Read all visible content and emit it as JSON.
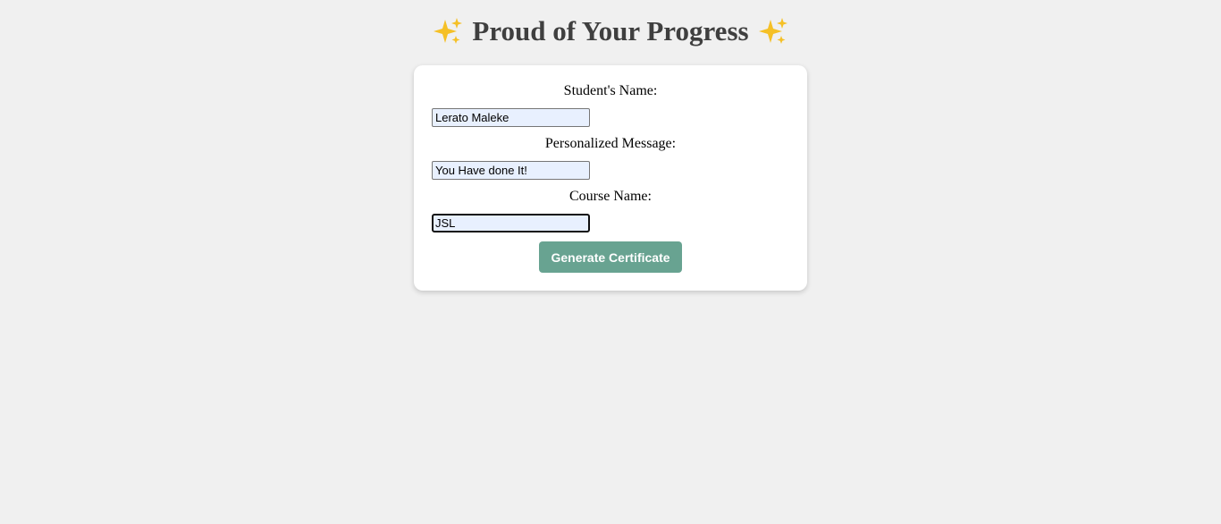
{
  "page": {
    "title": "Proud of Your Progress",
    "title_icon": "sparkles-icon",
    "title_icon_color": "#f5c026"
  },
  "form": {
    "student_name": {
      "label": "Student's Name:",
      "value": "Lerato Maleke"
    },
    "message": {
      "label": "Personalized Message:",
      "value": "You Have done It!"
    },
    "course": {
      "label": "Course Name:",
      "value": "JSL"
    },
    "submit_label": "Generate Certificate"
  },
  "colors": {
    "background": "#f0f0f0",
    "card": "#ffffff",
    "button": "#68a391",
    "autofill": "#e8f0fe"
  }
}
